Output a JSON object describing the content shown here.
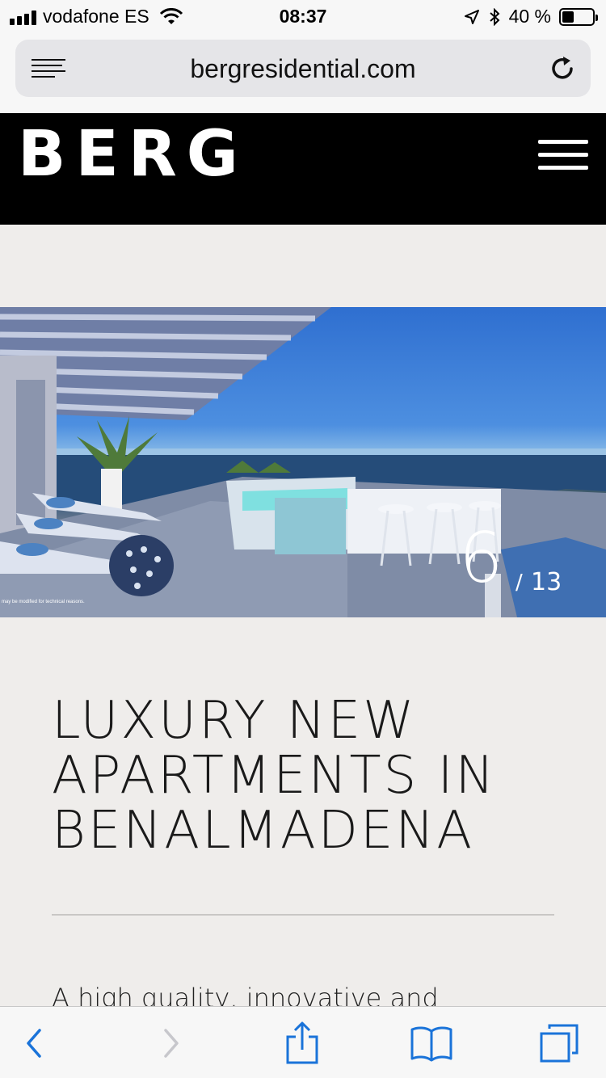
{
  "status_bar": {
    "carrier": "vodafone ES",
    "time": "08:37",
    "battery_text": "40 %",
    "battery_level": 0.4,
    "icons": [
      "signal-icon",
      "wifi-icon",
      "location-icon",
      "bluetooth-icon",
      "battery-icon"
    ]
  },
  "browser": {
    "url": "bergresidential.com",
    "icons": [
      "reader-icon",
      "reload-icon"
    ]
  },
  "site": {
    "logo": "BERG",
    "menu_icon": "hamburger-icon"
  },
  "hero": {
    "current": "6",
    "separator": "/",
    "total": "13",
    "disclaimer": "may be modified for technical reasons."
  },
  "content": {
    "headline": "LUXURY NEW APARTMENTS IN BENALMADENA",
    "intro": "A high quality, innovative and sustainable"
  },
  "toolbar": {
    "icons": [
      "back-icon",
      "forward-icon",
      "share-icon",
      "bookmarks-icon",
      "tabs-icon"
    ],
    "accent": "#1a73d9",
    "disabled": "#c7c7cc"
  }
}
